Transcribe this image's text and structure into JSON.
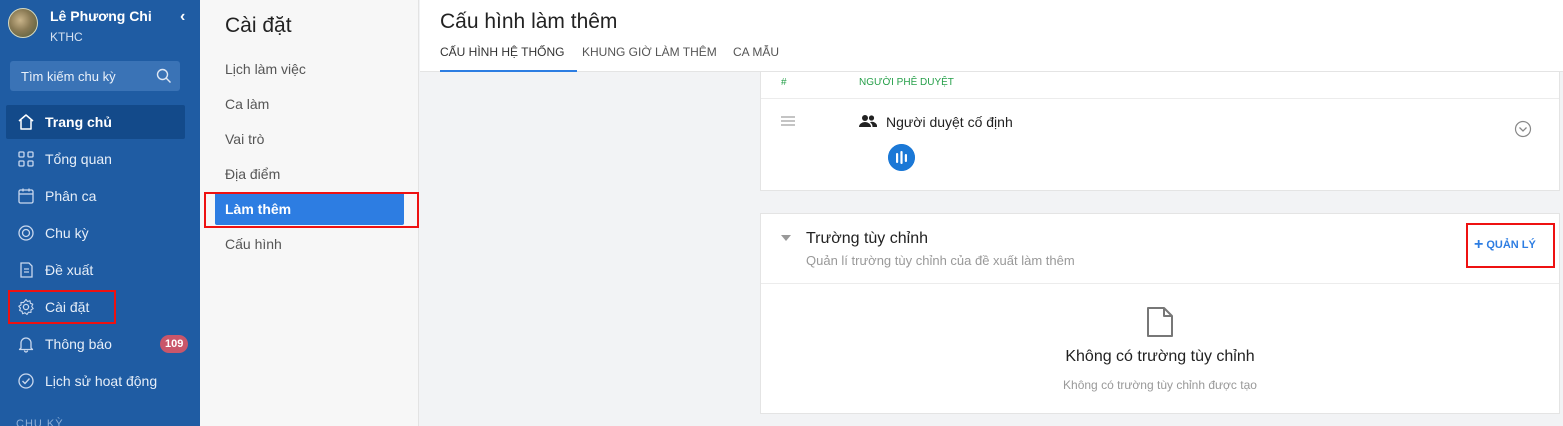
{
  "user": {
    "name": "Lê Phương Chi",
    "department": "KTHC"
  },
  "search": {
    "placeholder": "Tìm kiếm chu kỳ"
  },
  "sidebar": {
    "items": [
      {
        "label": "Trang chủ",
        "icon": "home-icon"
      },
      {
        "label": "Tổng quan",
        "icon": "grid-icon"
      },
      {
        "label": "Phân ca",
        "icon": "calendar-icon"
      },
      {
        "label": "Chu kỳ",
        "icon": "cycle-icon"
      },
      {
        "label": "Đề xuất",
        "icon": "document-icon"
      },
      {
        "label": "Cài đặt",
        "icon": "gear-icon"
      },
      {
        "label": "Thông báo",
        "icon": "bell-icon",
        "badge": "109"
      },
      {
        "label": "Lịch sử hoạt động",
        "icon": "check-circle-icon"
      }
    ],
    "section_label": "CHU KỲ"
  },
  "settings": {
    "title": "Cài đặt",
    "items": [
      "Lịch làm việc",
      "Ca làm",
      "Vai trò",
      "Địa điểm",
      "Làm thêm",
      "Cấu hình"
    ],
    "active": "Làm thêm"
  },
  "main": {
    "title": "Cấu hình làm thêm",
    "tabs": [
      "CẤU HÌNH HỆ THỐNG",
      "KHUNG GIỜ LÀM THÊM",
      "CA MẪU"
    ]
  },
  "approvers": {
    "col_hash": "#",
    "col_approver": "NGƯỜI PHÊ DUYỆT",
    "row_label": "Người duyệt cố định"
  },
  "custom_fields": {
    "title": "Trường tùy chỉnh",
    "subtitle": "Quản lí trường tùy chỉnh của đề xuất làm thêm",
    "manage_label": "QUẢN LÝ",
    "empty_title": "Không có trường tùy chỉnh",
    "empty_subtitle": "Không có trường tùy chỉnh được tạo"
  },
  "colors": {
    "sidebar": "#1f5ca3",
    "accent": "#2d7de2",
    "highlight": "#e11111",
    "badge": "#c9566a"
  }
}
